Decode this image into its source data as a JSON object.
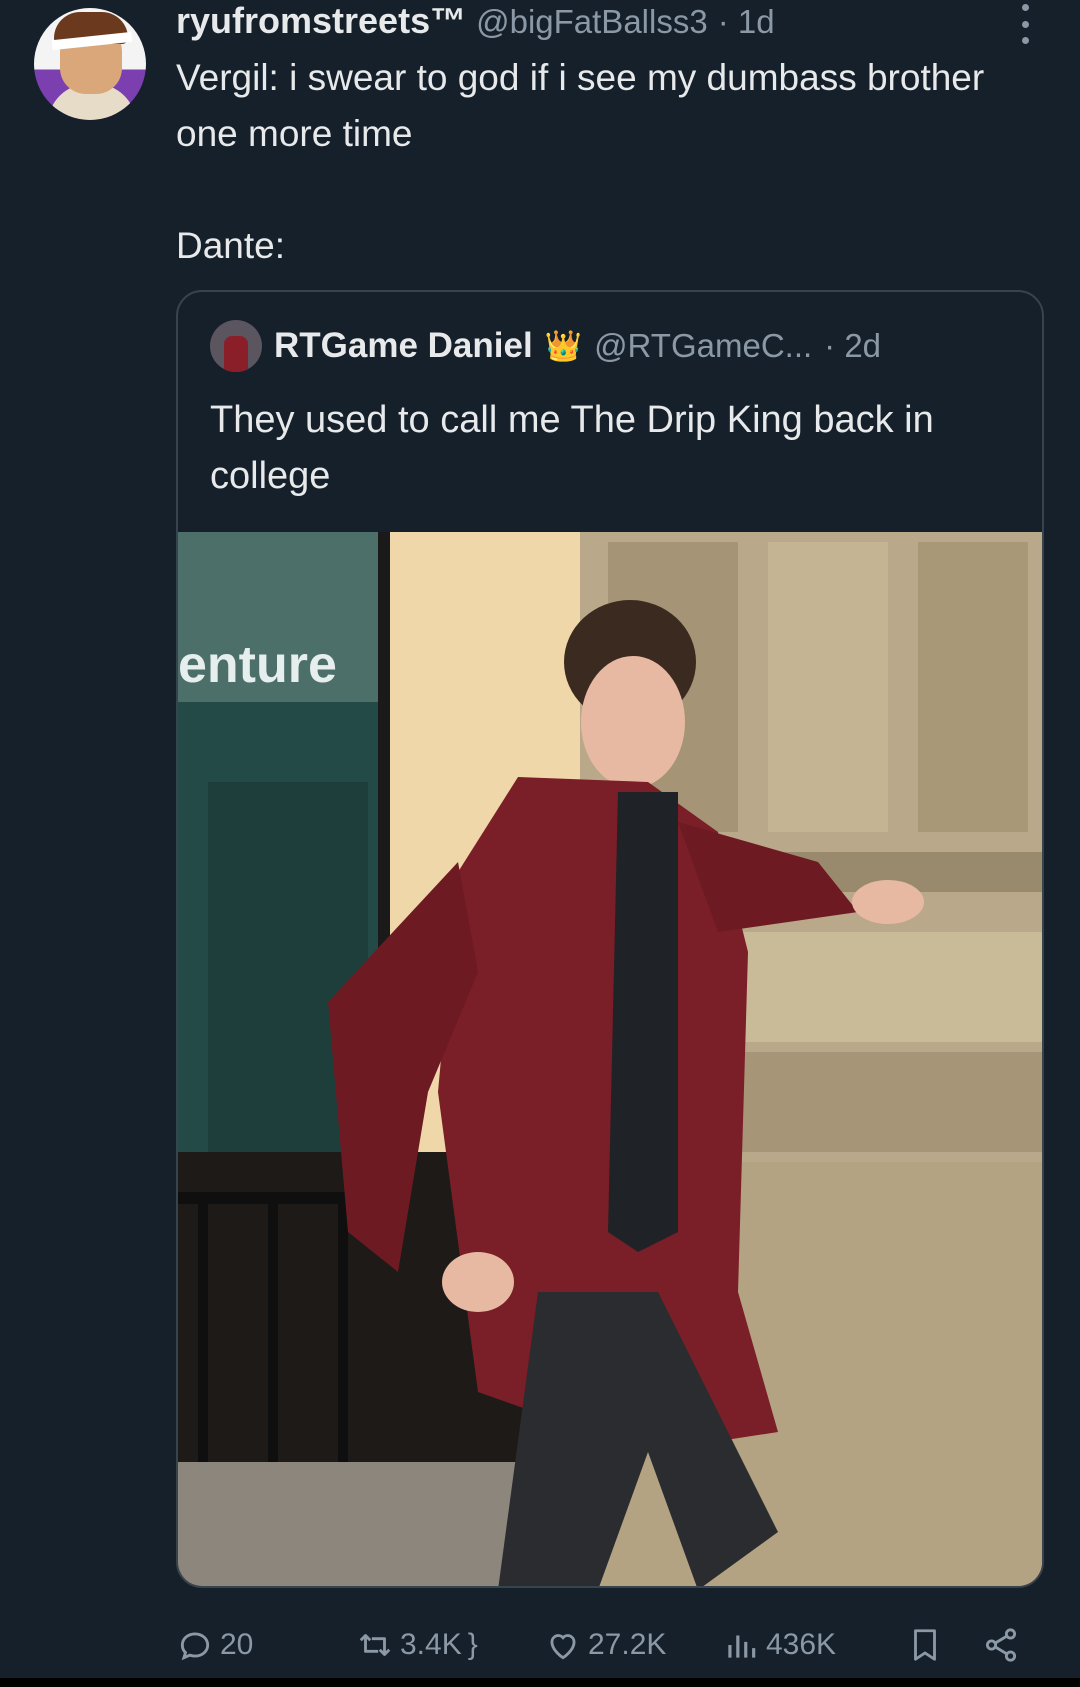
{
  "tweet": {
    "display_name": "ryufromstreets™",
    "handle": "@bigFatBallss3",
    "time": "· 1d",
    "text_line1": "Vergil: i swear to god if i see my dumbass brother one more time",
    "text_line2": "Dante:"
  },
  "quoted": {
    "display_name": "RTGame Daniel",
    "badge": "👑",
    "handle": "@RTGameC...",
    "time": "· 2d",
    "text": "They used to call me The Drip King back in college",
    "sign_text": "enture"
  },
  "actions": {
    "replies": "20",
    "reposts": "3.4K",
    "likes": "27.2K",
    "views": "436K"
  },
  "colors": {
    "background": "#15202b",
    "text": "#e7e9ea",
    "secondary": "#8b98a5",
    "border": "#38444d"
  }
}
